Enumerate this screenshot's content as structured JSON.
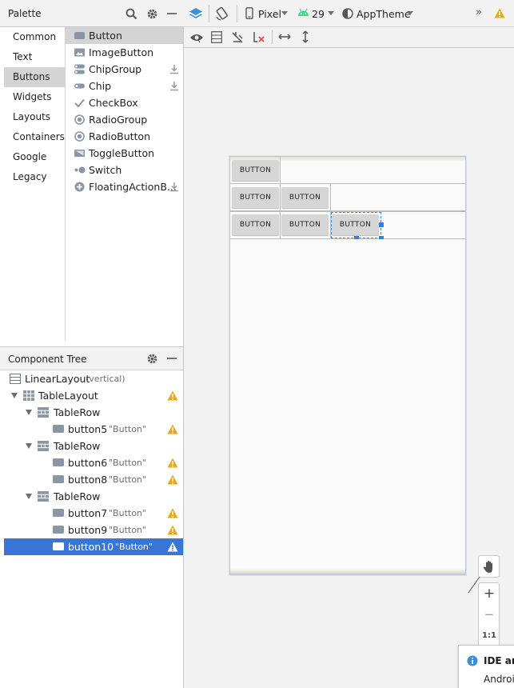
{
  "palette": {
    "title": "Palette",
    "categories": [
      "Common",
      "Text",
      "Buttons",
      "Widgets",
      "Layouts",
      "Containers",
      "Google",
      "Legacy"
    ],
    "selected_category": "Buttons",
    "widgets": [
      {
        "label": "Button",
        "icon": "button-icon",
        "download": false
      },
      {
        "label": "ImageButton",
        "icon": "image-button-icon",
        "download": false
      },
      {
        "label": "ChipGroup",
        "icon": "chip-group-icon",
        "download": true
      },
      {
        "label": "Chip",
        "icon": "chip-icon",
        "download": true
      },
      {
        "label": "CheckBox",
        "icon": "checkbox-icon",
        "download": false
      },
      {
        "label": "RadioGroup",
        "icon": "radio-group-icon",
        "download": false
      },
      {
        "label": "RadioButton",
        "icon": "radio-button-icon",
        "download": false
      },
      {
        "label": "ToggleButton",
        "icon": "toggle-button-icon",
        "download": false
      },
      {
        "label": "Switch",
        "icon": "switch-icon",
        "download": false
      },
      {
        "label": "FloatingActionB...",
        "icon": "fab-icon",
        "download": true
      }
    ]
  },
  "tree": {
    "title": "Component Tree",
    "rows": [
      {
        "label": "LinearLayout",
        "sub": "(vertical)",
        "warn": false
      },
      {
        "label": "TableLayout",
        "sub": "",
        "warn": true
      },
      {
        "label": "TableRow",
        "sub": "",
        "warn": false
      },
      {
        "label": "button5",
        "sub": "\"Button\"",
        "warn": true
      },
      {
        "label": "TableRow",
        "sub": "",
        "warn": false
      },
      {
        "label": "button6",
        "sub": "\"Button\"",
        "warn": true
      },
      {
        "label": "button8",
        "sub": "\"Button\"",
        "warn": true
      },
      {
        "label": "TableRow",
        "sub": "",
        "warn": false
      },
      {
        "label": "button7",
        "sub": "\"Button\"",
        "warn": true
      },
      {
        "label": "button9",
        "sub": "\"Button\"",
        "warn": true
      },
      {
        "label": "button10",
        "sub": "\"Button\"",
        "warn": true
      }
    ]
  },
  "toolbar": {
    "device": "Pixel",
    "api": "29",
    "theme": "AppTheme",
    "overflow": "»"
  },
  "canvas": {
    "button_label": "BUTTON"
  },
  "zoom": {
    "plus": "+",
    "minus": "−",
    "actual": "1:1"
  },
  "notification": {
    "title": "IDE and",
    "body": "Android"
  },
  "colors": {
    "accent": "#3875d7",
    "warning": "#e6a817",
    "android_green": "#3ddc84"
  }
}
